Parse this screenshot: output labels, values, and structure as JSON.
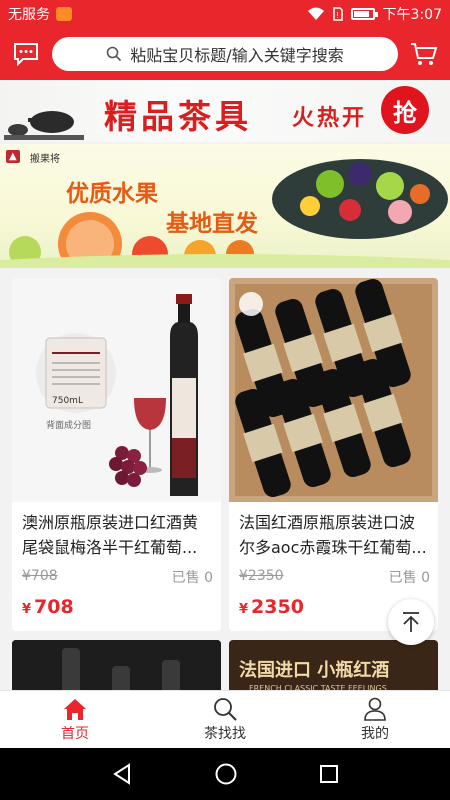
{
  "status_bar": {
    "carrier": "无服务",
    "time": "下午3:07",
    "battery_level": 0.85
  },
  "header": {
    "search_placeholder": "粘贴宝贝标题/输入关键字搜索",
    "icons": [
      "message-icon",
      "search-icon",
      "cart-icon"
    ]
  },
  "banners": [
    {
      "title": "精品茶具",
      "subtitle": "火热开",
      "badge": "抢"
    },
    {
      "brand": "搬果将",
      "line1": "优质水果",
      "line2": "基地直发"
    }
  ],
  "products": [
    {
      "name": "澳洲原瓶原装进口红酒黄尾袋鼠梅洛半干红葡萄...",
      "original_price": "¥708",
      "sold": "已售 0",
      "currency": "¥",
      "price": "708",
      "image_caption": "背面成分图",
      "label_text": "750mL"
    },
    {
      "name": "法国红酒原瓶原装进口波尔多aoc赤霞珠干红葡萄...",
      "original_price": "¥2350",
      "sold": "已售 0",
      "currency": "¥",
      "price": "2350"
    }
  ],
  "partial_cards": [
    {
      "text": ""
    },
    {
      "text": "法国进口 小瓶红酒",
      "subtext": "FRENCH CLASSIC TASTE FEELINGS"
    }
  ],
  "bottom_nav": [
    {
      "label": "首页",
      "icon": "home-icon",
      "active": true
    },
    {
      "label": "茶找找",
      "icon": "search-icon",
      "active": false
    },
    {
      "label": "我的",
      "icon": "user-icon",
      "active": false
    }
  ],
  "colors": {
    "brand_red": "#e8262b"
  }
}
